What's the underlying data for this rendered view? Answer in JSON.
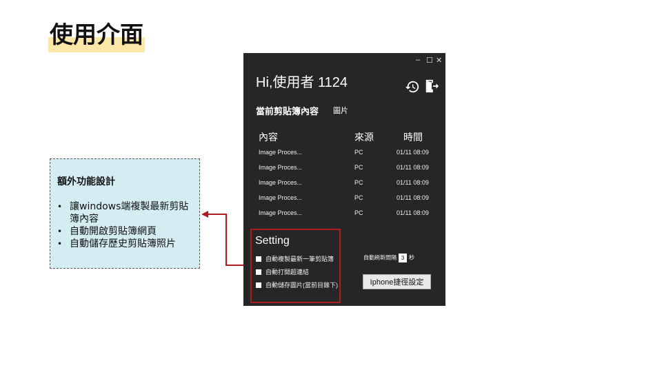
{
  "slide": {
    "title": "使用介面"
  },
  "note": {
    "title": "額外功能設計",
    "items": [
      "讓windows端複製最新剪貼簿內容",
      "自動開啟剪貼簿網頁",
      "自動儲存歷史剪貼簿照片"
    ]
  },
  "app": {
    "window_controls": {
      "minimize": "–",
      "maximize": "☐",
      "close": "✕"
    },
    "greeting": "Hi,使用者 1124",
    "icons": {
      "history": "history-icon",
      "logout": "logout-icon"
    },
    "clipboard_label": "當前剪貼簿內容",
    "clipboard_type": "圖片",
    "table": {
      "headers": [
        "內容",
        "來源",
        "時間"
      ],
      "rows": [
        [
          "Image Proces...",
          "PC",
          "01/11 08:09"
        ],
        [
          "Image Proces...",
          "PC",
          "01/11 08:09"
        ],
        [
          "Image Proces...",
          "PC",
          "01/11 08:09"
        ],
        [
          "Image Proces...",
          "PC",
          "01/11 08:09"
        ],
        [
          "Image Proces...",
          "PC",
          "01/11 08:09"
        ]
      ]
    },
    "settings": {
      "title": "Setting",
      "options": [
        "自動複製最新一筆剪貼簿",
        "自動打開超連結",
        "自動儲存圖片(當前目錄下)"
      ],
      "refresh_label": "自動刷新間隔",
      "refresh_value": "3",
      "refresh_unit": "秒",
      "iphone_button": "Iphone捷徑設定"
    }
  },
  "colors": {
    "app_bg": "#262626",
    "highlight": "#fbe7a8",
    "note_bg": "#d4edf2",
    "annotation_red": "#b01c1c"
  }
}
